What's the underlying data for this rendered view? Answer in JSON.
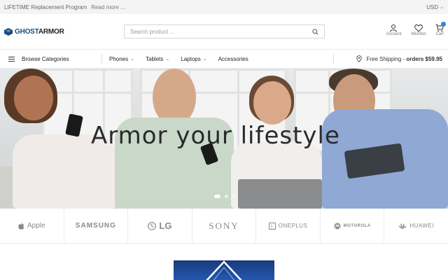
{
  "topbar": {
    "promo_text": "LIFETIME Replacement Program",
    "read_more": "Read more ...",
    "currency": "USD"
  },
  "header": {
    "logo_part1": "GHOST",
    "logo_part2": "ARMOR",
    "search_placeholder": "Search product ...",
    "actions": [
      {
        "label": "Account",
        "icon": "user-icon"
      },
      {
        "label": "Wishlist",
        "icon": "heart-icon"
      },
      {
        "label": "Cart",
        "icon": "cart-icon"
      }
    ]
  },
  "nav": {
    "browse_label": "Browse Categories",
    "menu": [
      {
        "label": "Phones",
        "has_dropdown": true
      },
      {
        "label": "Tablets",
        "has_dropdown": true
      },
      {
        "label": "Laptops",
        "has_dropdown": true
      },
      {
        "label": "Accessories",
        "has_dropdown": false
      }
    ],
    "shipping_text": "Free Shipping - ",
    "shipping_bold": "orders $59.95"
  },
  "hero": {
    "title": "Armor your lifestyle",
    "slides": 3,
    "active_slide": 1
  },
  "brands": [
    {
      "name": "Apple",
      "icon": "apple-icon"
    },
    {
      "name": "SAMSUNG"
    },
    {
      "name": "LG",
      "icon": "lg-icon"
    },
    {
      "name": "SONY"
    },
    {
      "name": "ONEPLUS",
      "icon": "oneplus-icon"
    },
    {
      "name": "MOTOROLA",
      "icon": "motorola-icon"
    },
    {
      "name": "HUAWEI",
      "icon": "huawei-icon"
    }
  ],
  "colors": {
    "brand_blue": "#1a4e7a",
    "accent": "#2a8ad8",
    "text": "#222222",
    "muted": "#8a8a8a"
  }
}
